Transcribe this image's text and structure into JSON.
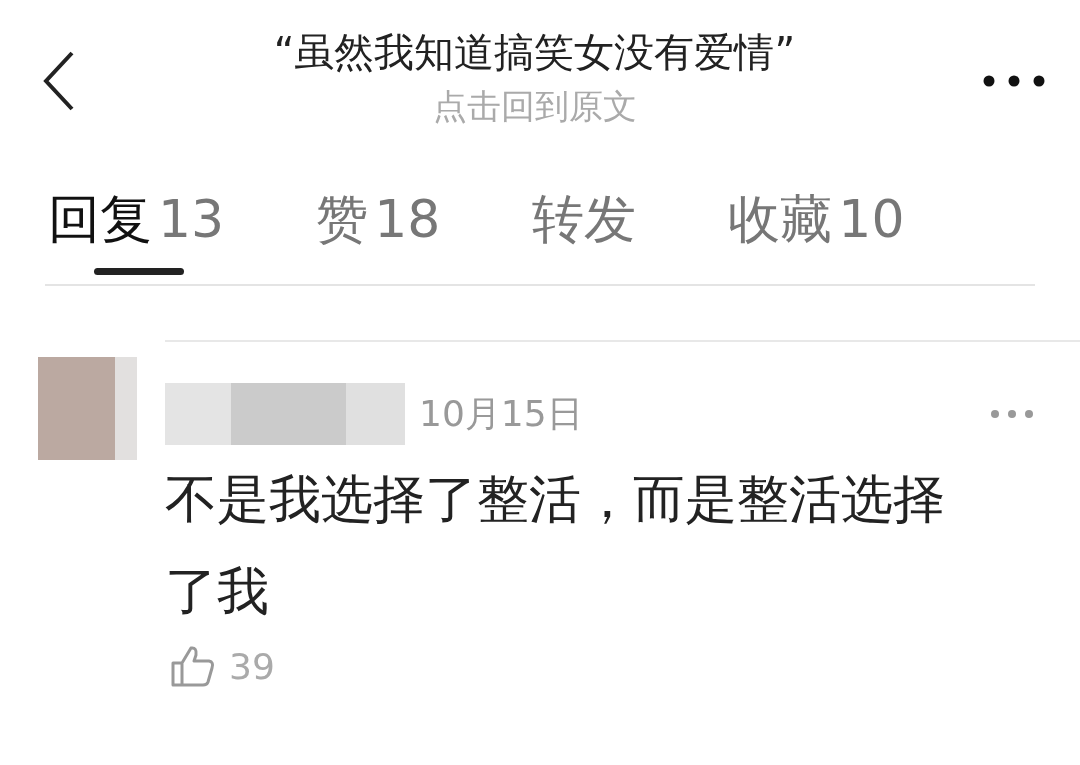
{
  "header": {
    "title": "“虽然我知道搞笑女没有爱情”",
    "subtitle": "点击回到原文"
  },
  "tabs": [
    {
      "label": "回复",
      "count": "13",
      "selected": true
    },
    {
      "label": "赞",
      "count": "18",
      "selected": false
    },
    {
      "label": "转发",
      "selected": false
    },
    {
      "label": "收藏",
      "count": "10",
      "selected": false
    }
  ],
  "comments": [
    {
      "date": "10月15日",
      "text": "不是我选择了整活，而是整活选择了我",
      "likes": "39"
    }
  ]
}
